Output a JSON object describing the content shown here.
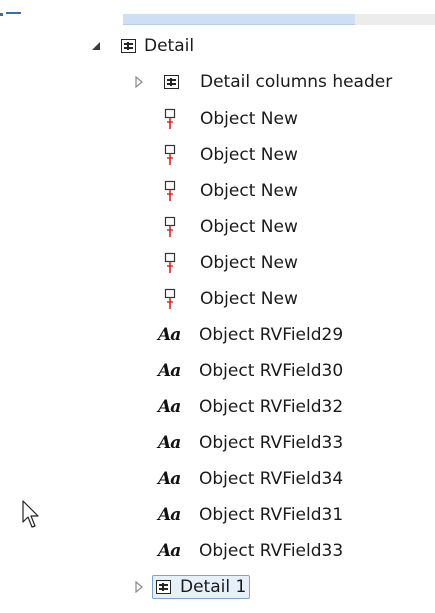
{
  "tree": {
    "detail": {
      "label": "Detail",
      "expanded": true,
      "children": {
        "header": {
          "label": "Detail columns header",
          "expanded": false
        },
        "objects_new": [
          {
            "label": "Object New"
          },
          {
            "label": "Object New"
          },
          {
            "label": "Object New"
          },
          {
            "label": "Object New"
          },
          {
            "label": "Object New"
          },
          {
            "label": "Object New"
          }
        ],
        "fields": [
          {
            "icon_text": "Aa",
            "label": "Object RVField29"
          },
          {
            "icon_text": "Aa",
            "label": "Object RVField30"
          },
          {
            "icon_text": "Aa",
            "label": "Object RVField32"
          },
          {
            "icon_text": "Aa",
            "label": "Object RVField33"
          },
          {
            "icon_text": "Aa",
            "label": "Object RVField34"
          },
          {
            "icon_text": "Aa",
            "label": "Object RVField31"
          },
          {
            "icon_text": "Aa",
            "label": "Object RVField33"
          }
        ]
      }
    },
    "detail1": {
      "label": "Detail 1",
      "expanded": false,
      "selected": true
    }
  },
  "icons": {
    "expanded": "triangle-expanded-icon",
    "collapsed": "triangle-collapsed-icon",
    "band": "band-grid-icon",
    "object": "object-connector-icon",
    "text_field": "text-field-icon",
    "cursor": "mouse-pointer-icon"
  },
  "colors": {
    "selection_border": "#7da2ce",
    "selection_fill": "#e6f0fb",
    "scroll_thumb": "#cfdff2",
    "connector_red": "#e02020"
  }
}
